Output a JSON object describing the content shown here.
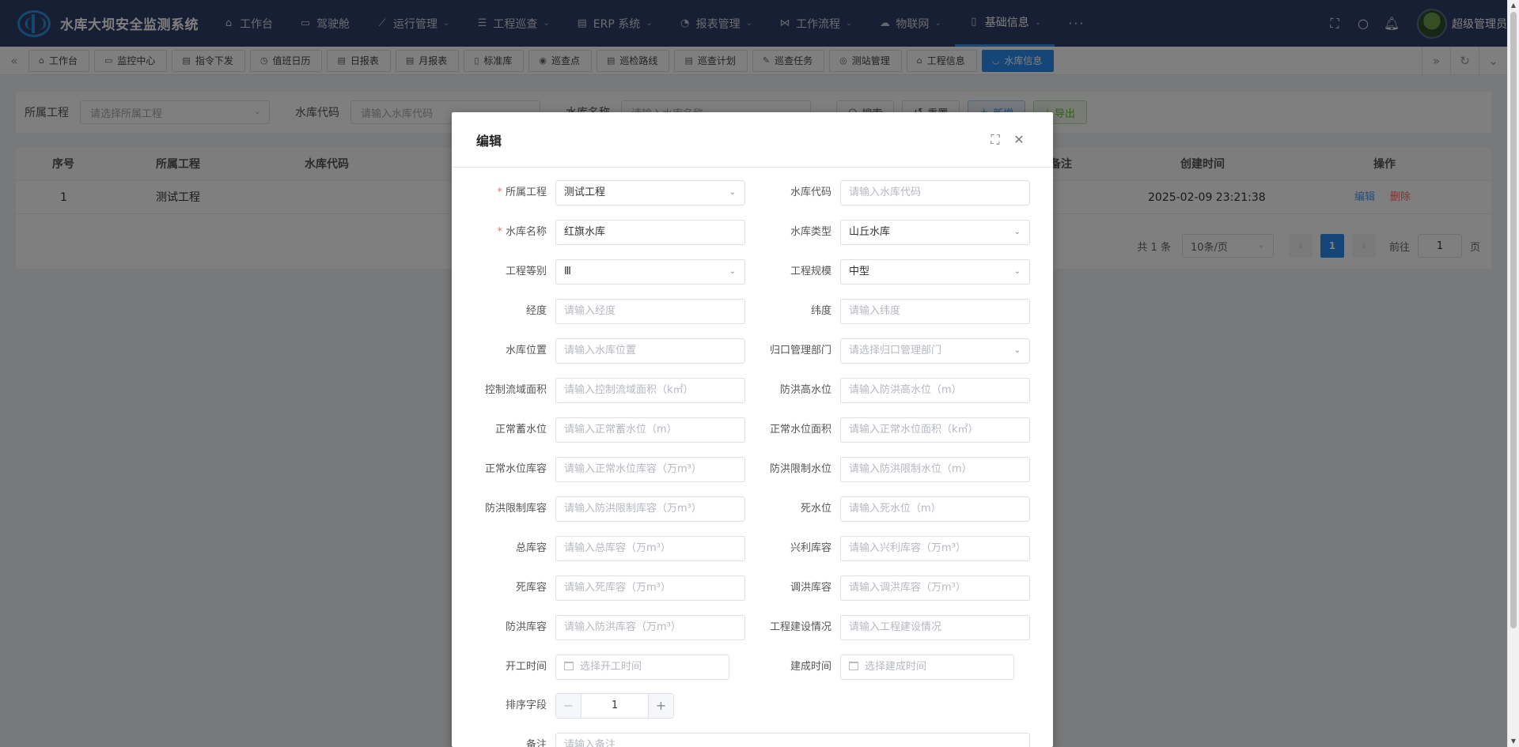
{
  "app": {
    "title": "水库大坝安全监测系统"
  },
  "nav": {
    "items": [
      {
        "label": "工作台",
        "icon": "home-icon",
        "glyph": "⌂",
        "arrow": ""
      },
      {
        "label": "驾驶舱",
        "icon": "monitor-icon",
        "glyph": "▭",
        "arrow": ""
      },
      {
        "label": "运行管理",
        "icon": "chart-line-icon",
        "glyph": "⟋",
        "arrow": "⌄"
      },
      {
        "label": "工程巡查",
        "icon": "sliders-icon",
        "glyph": "☰",
        "arrow": "⌄"
      },
      {
        "label": "ERP 系统",
        "icon": "database-icon",
        "glyph": "▤",
        "arrow": "⌄"
      },
      {
        "label": "报表管理",
        "icon": "pie-chart-icon",
        "glyph": "◔",
        "arrow": "⌄"
      },
      {
        "label": "工作流程",
        "icon": "workflow-icon",
        "glyph": "⋈",
        "arrow": "⌄"
      },
      {
        "label": "物联网",
        "icon": "iot-icon",
        "glyph": "☁",
        "arrow": "⌄"
      },
      {
        "label": "基础信息",
        "icon": "document-icon",
        "glyph": "▯",
        "arrow": "⌄",
        "active": true
      }
    ],
    "more": "···",
    "username": "超级管理员"
  },
  "tags": [
    {
      "label": "工作台",
      "glyph": "⌂"
    },
    {
      "label": "监控中心",
      "glyph": "▭"
    },
    {
      "label": "指令下发",
      "glyph": "▤"
    },
    {
      "label": "值班日历",
      "glyph": "◷"
    },
    {
      "label": "日报表",
      "glyph": "▤"
    },
    {
      "label": "月报表",
      "glyph": "▤"
    },
    {
      "label": "标准库",
      "glyph": "▯"
    },
    {
      "label": "巡查点",
      "glyph": "◉"
    },
    {
      "label": "巡检路线",
      "glyph": "▤"
    },
    {
      "label": "巡查计划",
      "glyph": "▤"
    },
    {
      "label": "巡查任务",
      "glyph": "✎"
    },
    {
      "label": "测站管理",
      "glyph": "◎"
    },
    {
      "label": "工程信息",
      "glyph": "⌂"
    },
    {
      "label": "水库信息",
      "glyph": "◡",
      "active": true
    }
  ],
  "search": {
    "project_label": "所属工程",
    "project_placeholder": "请选择所属工程",
    "code_label": "水库代码",
    "code_placeholder": "请输入水库代码",
    "name_label": "水库名称",
    "name_placeholder": "请输入水库名称",
    "search_btn": "搜索",
    "reset_btn": "重置",
    "add_btn": "新增",
    "export_btn": "导出"
  },
  "table": {
    "headers": {
      "index": "序号",
      "project": "所属工程",
      "code": "水库代码",
      "remark": "备注",
      "created": "创建时间",
      "actions": "操作"
    },
    "rows": [
      {
        "index": "1",
        "project": "测试工程",
        "created": "2025-02-09 23:21:38",
        "edit": "编辑",
        "delete": "删除"
      }
    ]
  },
  "pager": {
    "total": "共 1 条",
    "size": "10条/页",
    "current": "1",
    "prev": "‹",
    "next": "›",
    "goto": "前往",
    "goto_value": "1",
    "page_unit": "页"
  },
  "dialog": {
    "title": "编辑",
    "rows": [
      {
        "l": {
          "label": "所属工程",
          "required": true,
          "value": "测试工程",
          "select": true
        },
        "r": {
          "label": "水库代码",
          "placeholder": "请输入水库代码"
        }
      },
      {
        "l": {
          "label": "水库名称",
          "required": true,
          "value": "红旗水库"
        },
        "r": {
          "label": "水库类型",
          "value": "山丘水库",
          "select": true
        }
      },
      {
        "l": {
          "label": "工程等别",
          "value": "Ⅲ",
          "select": true
        },
        "r": {
          "label": "工程规模",
          "value": "中型",
          "select": true
        }
      },
      {
        "l": {
          "label": "经度",
          "placeholder": "请输入经度"
        },
        "r": {
          "label": "纬度",
          "placeholder": "请输入纬度"
        }
      },
      {
        "l": {
          "label": "水库位置",
          "placeholder": "请输入水库位置"
        },
        "r": {
          "label": "归口管理部门",
          "placeholder": "请选择归口管理部门",
          "select": true
        }
      },
      {
        "l": {
          "label": "控制流域面积",
          "placeholder": "请输入控制流域面积（k㎡）"
        },
        "r": {
          "label": "防洪高水位",
          "placeholder": "请输入防洪高水位（m）"
        }
      },
      {
        "l": {
          "label": "正常蓄水位",
          "placeholder": "请输入正常蓄水位（m）"
        },
        "r": {
          "label": "正常水位面积",
          "placeholder": "请输入正常水位面积（k㎡）"
        }
      },
      {
        "l": {
          "label": "正常水位库容",
          "placeholder": "请输入正常水位库容（万m³）"
        },
        "r": {
          "label": "防洪限制水位",
          "placeholder": "请输入防洪限制水位（m）"
        }
      },
      {
        "l": {
          "label": "防洪限制库容",
          "placeholder": "请输入防洪限制库容（万m³）"
        },
        "r": {
          "label": "死水位",
          "placeholder": "请输入死水位（m）"
        }
      },
      {
        "l": {
          "label": "总库容",
          "placeholder": "请输入总库容（万m³）"
        },
        "r": {
          "label": "兴利库容",
          "placeholder": "请输入兴利库容（万m³）"
        }
      },
      {
        "l": {
          "label": "死库容",
          "placeholder": "请输入死库容（万m³）"
        },
        "r": {
          "label": "调洪库容",
          "placeholder": "请输入调洪库容（万m³）"
        }
      },
      {
        "l": {
          "label": "防洪库容",
          "placeholder": "请输入防洪库容（万m³）"
        },
        "r": {
          "label": "工程建设情况",
          "placeholder": "请输入工程建设情况"
        }
      },
      {
        "l": {
          "label": "开工时间",
          "placeholder": "选择开工时间",
          "date": true
        },
        "r": {
          "label": "建成时间",
          "placeholder": "选择建成时间",
          "date": true
        }
      }
    ],
    "sort": {
      "label": "排序字段",
      "value": "1",
      "minus": "−",
      "plus": "+"
    },
    "remark": {
      "label": "备注",
      "placeholder": "请输入备注"
    }
  }
}
